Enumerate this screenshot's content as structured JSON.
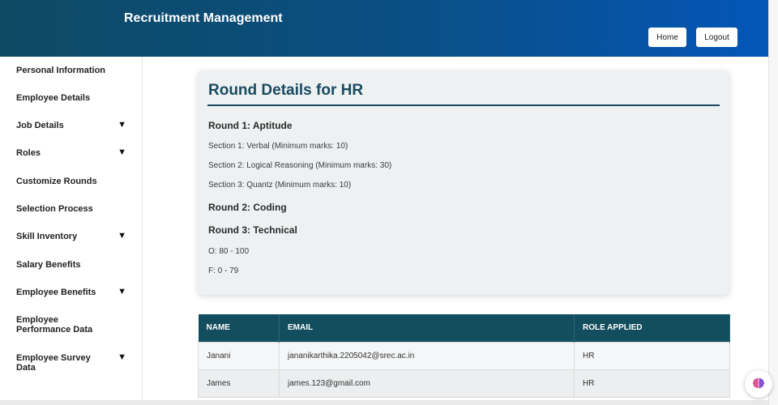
{
  "header": {
    "title": "Recruitment Management",
    "home_label": "Home",
    "logout_label": "Logout"
  },
  "sidebar": {
    "items": [
      {
        "label": "Personal Information",
        "has_caret": false
      },
      {
        "label": "Employee Details",
        "has_caret": false
      },
      {
        "label": "Job Details",
        "has_caret": true
      },
      {
        "label": "Roles",
        "has_caret": true
      },
      {
        "label": "Customize Rounds",
        "has_caret": false
      },
      {
        "label": "Selection Process",
        "has_caret": false
      },
      {
        "label": "Skill Inventory",
        "has_caret": true
      },
      {
        "label": "Salary Benefits",
        "has_caret": false
      },
      {
        "label": "Employee Benefits",
        "has_caret": true
      },
      {
        "label": "Employee Performance Data",
        "has_caret": false
      },
      {
        "label": "Employee Survey Data",
        "has_caret": true
      }
    ],
    "caret_glyph": "▼"
  },
  "card": {
    "title": "Round Details for HR",
    "round1": {
      "heading": "Round 1: Aptitude",
      "sections": [
        "Section 1: Verbal (Minimum marks: 10)",
        "Section 2: Logical Reasoning (Minimum marks: 30)",
        "Section 3: Quantz (Minimum marks: 10)"
      ]
    },
    "round2": {
      "heading": "Round 2: Coding"
    },
    "round3": {
      "heading": "Round 3: Technical",
      "grades": [
        "O: 80 - 100",
        "F: 0 - 79"
      ]
    }
  },
  "table": {
    "headers": [
      "NAME",
      "EMAIL",
      "ROLE APPLIED"
    ],
    "rows": [
      [
        "Janani",
        "jananikarthika.2205042@srec.ac.in",
        "HR"
      ],
      [
        "James",
        "james.123@gmail.com",
        "HR"
      ]
    ]
  },
  "colors": {
    "header_start": "#0e4a63",
    "header_end": "#0456b8",
    "table_header": "#134e5e",
    "card_title": "#184a60"
  },
  "icons": {
    "assistant": "brain-icon"
  }
}
